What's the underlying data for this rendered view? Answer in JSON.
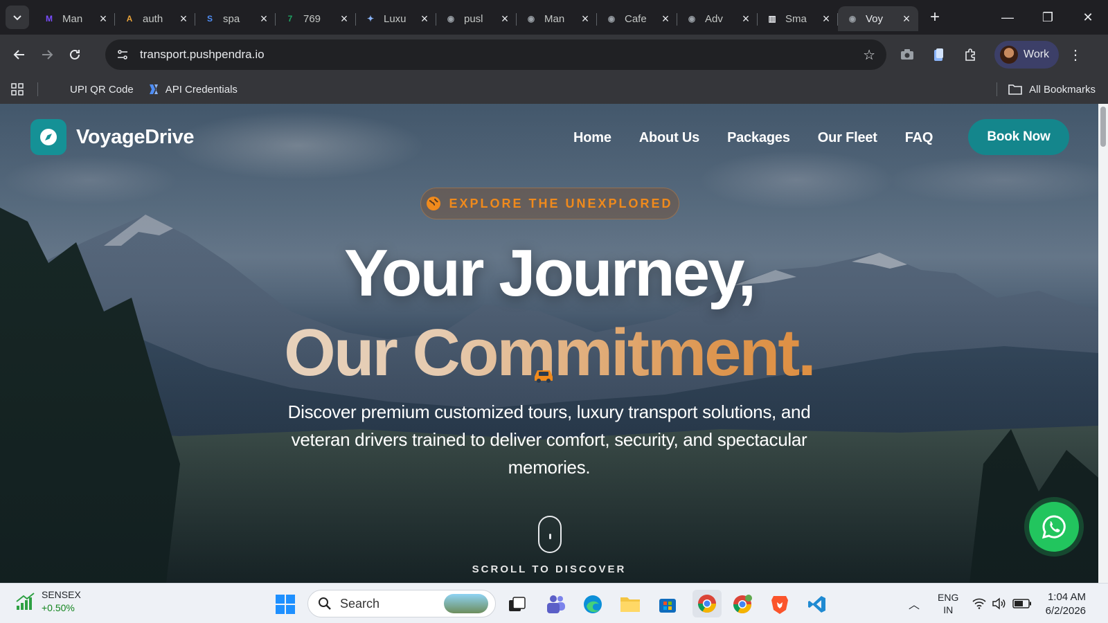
{
  "browser": {
    "tabs": [
      {
        "label": "Man",
        "favicon_color": "#7a4dff",
        "favicon": "M"
      },
      {
        "label": "auth",
        "favicon_color": "#e7a23a",
        "favicon": "A"
      },
      {
        "label": "spa",
        "favicon_color": "#4f8ef7",
        "favicon": "S"
      },
      {
        "label": "769",
        "favicon_color": "#1fa463",
        "favicon": "7"
      },
      {
        "label": "Luxu",
        "favicon_color": "#8ab4f8",
        "favicon": "✦"
      },
      {
        "label": "pusl",
        "favicon_color": "#9aa0a6",
        "favicon": "◉"
      },
      {
        "label": "Man",
        "favicon_color": "#9aa0a6",
        "favicon": "◉"
      },
      {
        "label": "Cafe",
        "favicon_color": "#9aa0a6",
        "favicon": "◉"
      },
      {
        "label": "Adv",
        "favicon_color": "#9aa0a6",
        "favicon": "◉"
      },
      {
        "label": "Sma",
        "favicon_color": "#e8eaed",
        "favicon": "▥"
      },
      {
        "label": "Voy",
        "favicon_color": "#9aa0a6",
        "favicon": "◉",
        "active": true
      }
    ],
    "url": "transport.pushpendra.io",
    "profile_label": "Work",
    "bookmarks": [
      {
        "label": "UPI QR Code",
        "icon": "none"
      },
      {
        "label": "API Credentials",
        "icon": "ribbon-icon"
      }
    ],
    "all_bookmarks_label": "All Bookmarks"
  },
  "site": {
    "brand": "VoyageDrive",
    "nav": [
      "Home",
      "About Us",
      "Packages",
      "Our Fleet",
      "FAQ"
    ],
    "cta": "Book Now",
    "badge": "EXPLORE THE UNEXPLORED",
    "headline_line1": "Your Journey,",
    "headline_line2": "Our Commitment.",
    "description": "Discover premium customized tours, luxury transport solutions, and veteran drivers trained to deliver comfort, security, and spectacular memories.",
    "scroll_hint": "SCROLL TO DISCOVER",
    "colors": {
      "brand_teal": "#14868c",
      "accent_orange": "#f08a1c",
      "whatsapp_green": "#22c55e"
    }
  },
  "taskbar": {
    "ticker_name": "SENSEX",
    "ticker_change": "+0.50%",
    "search_placeholder": "Search",
    "lang_line1": "ENG",
    "lang_line2": "IN",
    "time": "1:04 AM",
    "date": "6/2/2026"
  }
}
